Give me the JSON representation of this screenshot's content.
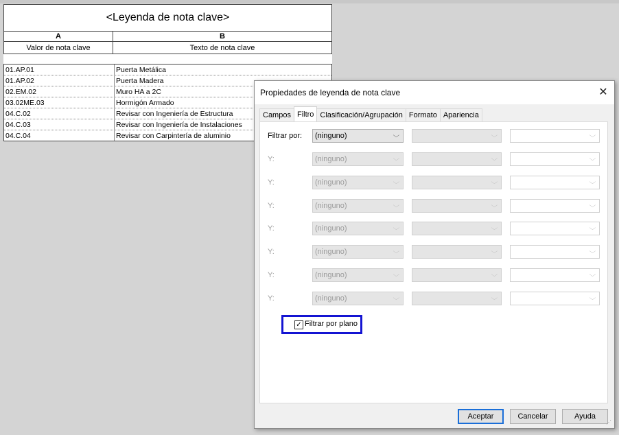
{
  "schedule": {
    "title": "<Leyenda de nota clave>",
    "col_letters": [
      "A",
      "B"
    ],
    "col_headers": [
      "Valor de nota clave",
      "Texto de nota clave"
    ],
    "rows": [
      [
        "01.AP.01",
        "Puerta Metálica"
      ],
      [
        "01.AP.02",
        "Puerta Madera"
      ],
      [
        "02.EM.02",
        "Muro HA a 2C"
      ],
      [
        "03.02ME.03",
        "Hormigón Armado"
      ],
      [
        "04.C.02",
        "Revisar con Ingeniería de Estructura"
      ],
      [
        "04.C.03",
        "Revisar con Ingeniería de Instalaciones"
      ],
      [
        "04.C.04",
        "Revisar con Carpintería de aluminio"
      ]
    ]
  },
  "dialog": {
    "title": "Propiedades de leyenda de nota clave",
    "close_glyph": "✕",
    "tabs": [
      "Campos",
      "Filtro",
      "Clasificación/Agrupación",
      "Formato",
      "Apariencia"
    ],
    "active_tab": "Filtro",
    "filter_rows": [
      {
        "label": "Filtrar por:",
        "value": "(ninguno)",
        "enabled": true
      },
      {
        "label": "Y:",
        "value": "(ninguno)",
        "enabled": false
      },
      {
        "label": "Y:",
        "value": "(ninguno)",
        "enabled": false
      },
      {
        "label": "Y:",
        "value": "(ninguno)",
        "enabled": false
      },
      {
        "label": "Y:",
        "value": "(ninguno)",
        "enabled": false
      },
      {
        "label": "Y:",
        "value": "(ninguno)",
        "enabled": false
      },
      {
        "label": "Y:",
        "value": "(ninguno)",
        "enabled": false
      },
      {
        "label": "Y:",
        "value": "(ninguno)",
        "enabled": false
      }
    ],
    "checkbox": {
      "label": "Filtrar por plano",
      "checked": true
    },
    "buttons": {
      "ok": "Aceptar",
      "cancel": "Cancelar",
      "help": "Ayuda"
    },
    "highlight_color": "#1414d2"
  }
}
